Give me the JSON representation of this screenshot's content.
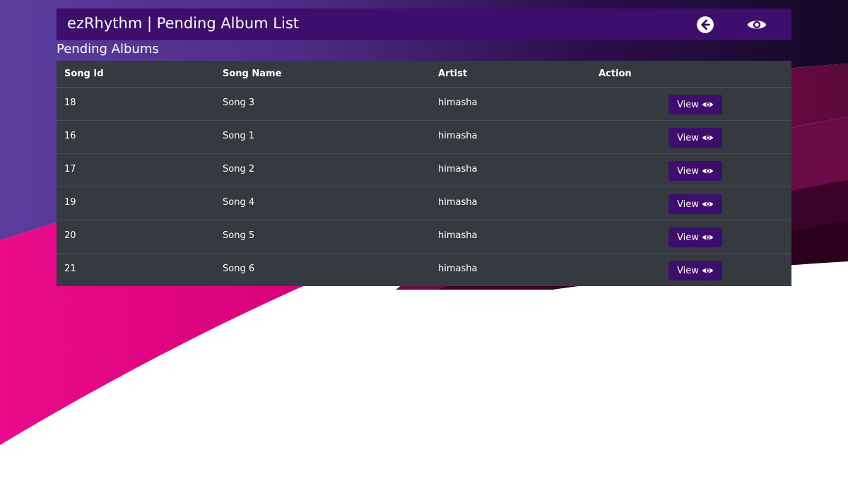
{
  "navbar": {
    "brand": "ezRhythm | Pending Album List",
    "back_icon": "arrow-circle-left-icon",
    "view_icon": "eye-icon"
  },
  "section": {
    "title": "Pending Albums"
  },
  "table": {
    "headers": [
      "Song Id",
      "Song Name",
      "Artist",
      "Action"
    ],
    "rows": [
      {
        "id": "18",
        "name": "Song 3",
        "artist": "himasha",
        "action": "View"
      },
      {
        "id": "16",
        "name": "Song 1",
        "artist": "himasha",
        "action": "View"
      },
      {
        "id": "17",
        "name": "Song 2",
        "artist": "himasha",
        "action": "View"
      },
      {
        "id": "19",
        "name": "Song 4",
        "artist": "himasha",
        "action": "View"
      },
      {
        "id": "20",
        "name": "Song 5",
        "artist": "himasha",
        "action": "View"
      },
      {
        "id": "21",
        "name": "Song 6",
        "artist": "himasha",
        "action": "View"
      }
    ]
  },
  "colors": {
    "navbar": "#3d0e6b",
    "table_bg": "#343a40",
    "button": "#3d0e6b",
    "bg_purple": "#5a3a9c",
    "bg_pink": "#e6007e",
    "bg_dark": "#1a0a2e"
  }
}
